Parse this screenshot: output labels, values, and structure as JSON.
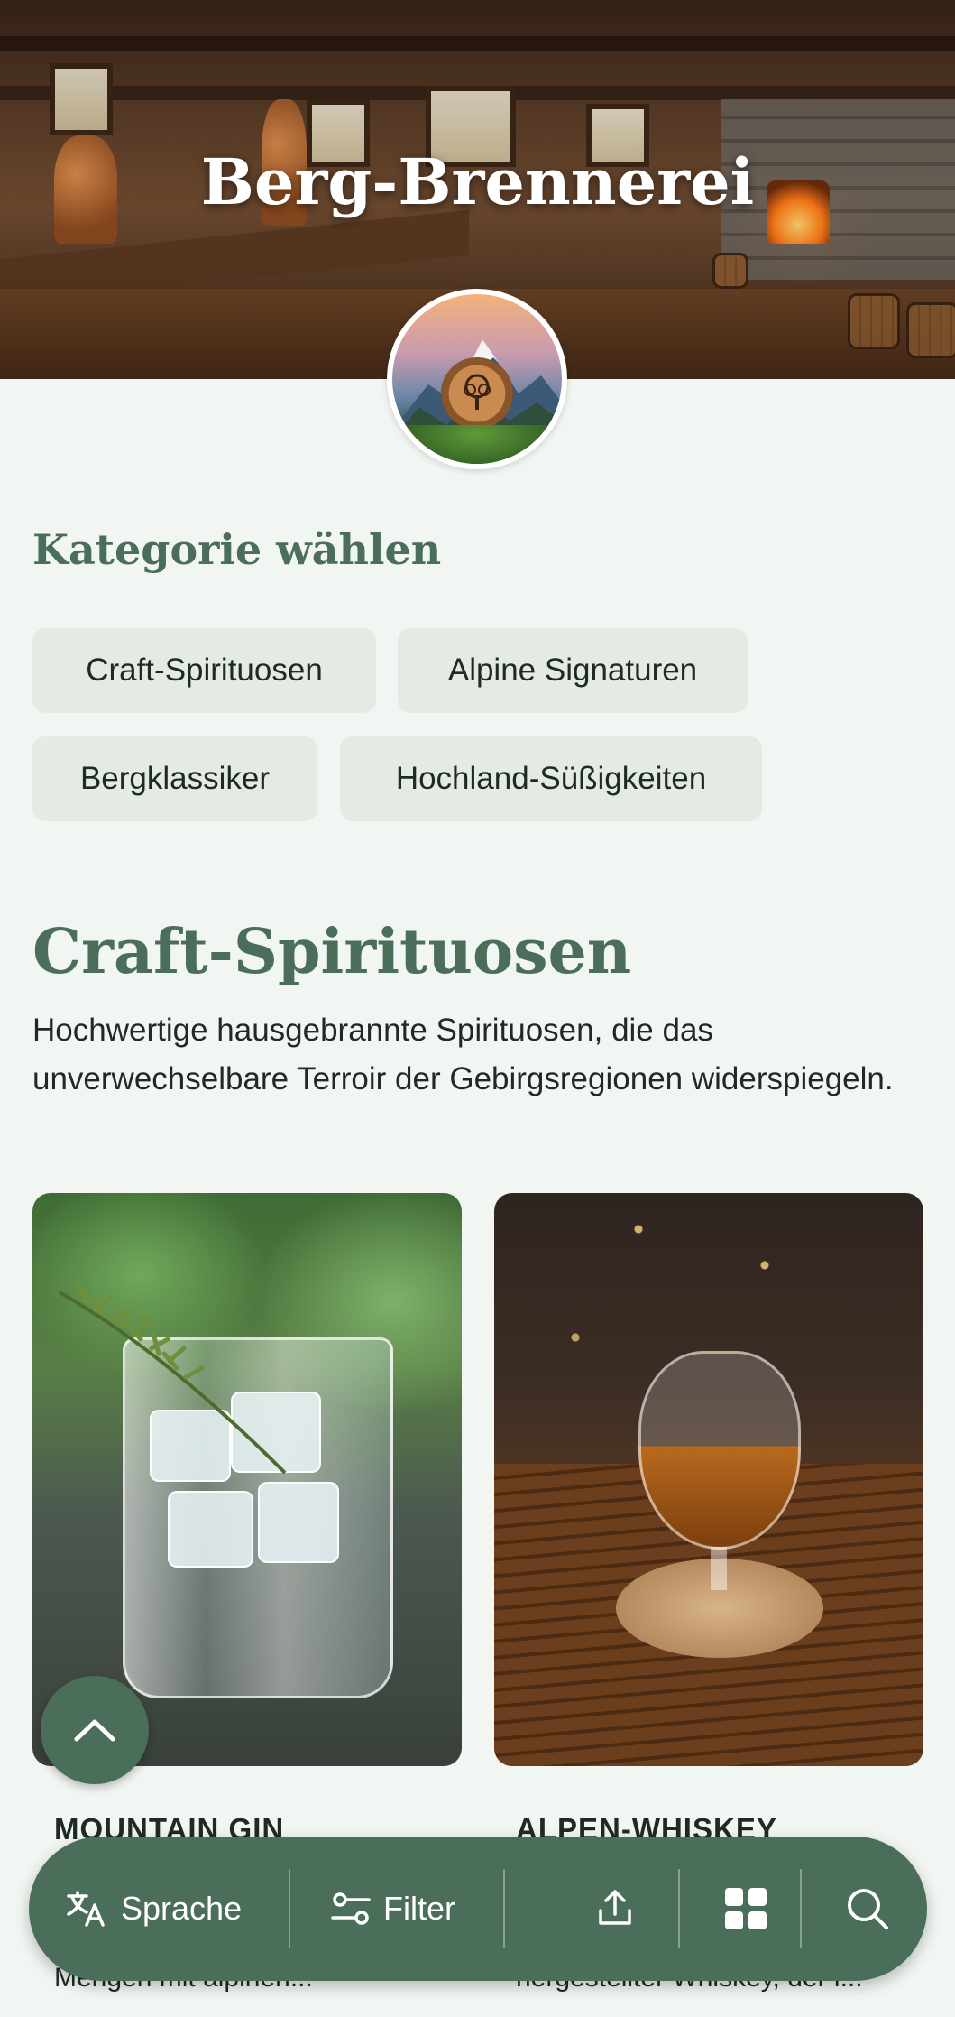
{
  "hero": {
    "title": "Berg-Brennerei"
  },
  "categories": {
    "heading": "Kategorie wählen",
    "items": [
      {
        "label": "Craft-Spirituosen"
      },
      {
        "label": "Alpine Signaturen"
      },
      {
        "label": "Bergklassiker"
      },
      {
        "label": "Hochland-Süßigkeiten"
      }
    ]
  },
  "section": {
    "title": "Craft-Spirituosen",
    "description": "Hochwertige hausgebrannte Spirituosen, die das unverwechselbare Terroir der Gebirgsregionen widerspiegeln."
  },
  "products": [
    {
      "name": "MOUNTAIN GIN",
      "description_snippet": "Mengen mit alpinen..."
    },
    {
      "name": "ALPEN-WHISKEY",
      "description_snippet": "hergestellter Whiskey, der i..."
    }
  ],
  "bottom_bar": {
    "language_label": "Sprache",
    "filter_label": "Filter",
    "icons": [
      "translate-icon",
      "filter-icon",
      "share-icon",
      "grid-icon",
      "search-icon"
    ]
  },
  "colors": {
    "accent": "#4a6e5a",
    "background": "#f2f6f2",
    "chip": "#e4ebe5",
    "text": "#1f2a24"
  }
}
